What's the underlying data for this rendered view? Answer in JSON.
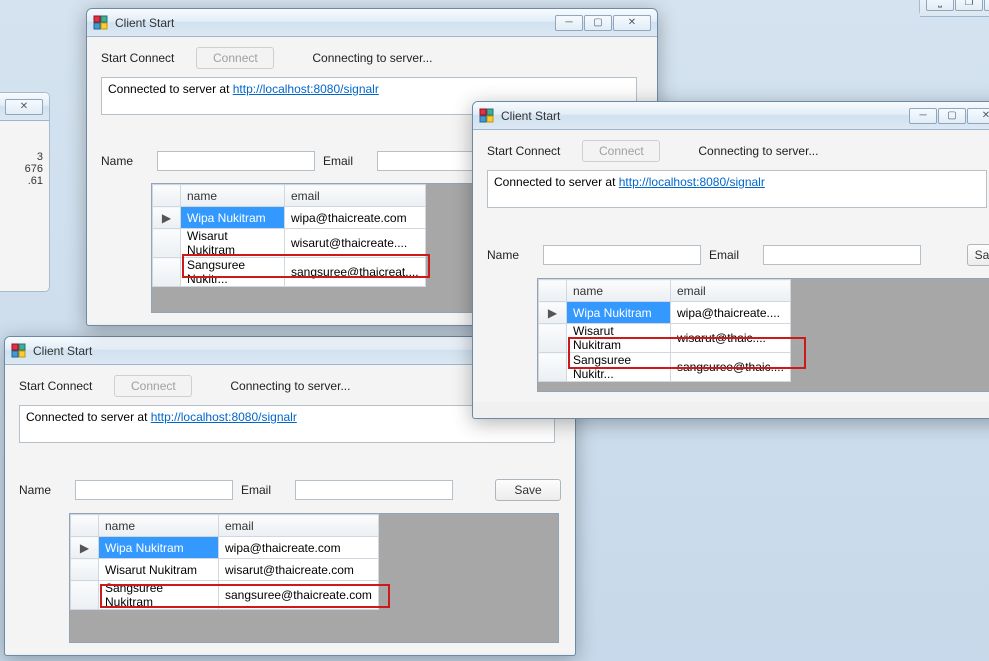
{
  "top_window_partial": {
    "control_min": "⎵",
    "control_max": "❐",
    "control_close": "✕",
    "stray_text": "3\n676\n.61"
  },
  "left_window_partial": {
    "control_close": "✕"
  },
  "window1": {
    "title": "Client Start",
    "start_connect": "Start Connect",
    "connect_btn": "Connect",
    "status": "Connecting to server...",
    "log_prefix": "Connected to server at ",
    "log_link": "http://localhost:8080/signalr",
    "name_label": "Name",
    "email_label": "Email",
    "control_min": "─",
    "control_max": "▢",
    "control_close": "✕",
    "grid": {
      "cols": [
        "name",
        "email"
      ],
      "rows": [
        {
          "selector": "▶",
          "name": "Wipa Nukitram",
          "email": "wipa@thaicreate.com",
          "selected": true
        },
        {
          "selector": "",
          "name": "Wisarut Nukitram",
          "email": "wisarut@thaicreate....",
          "selected": false
        },
        {
          "selector": "",
          "name": "Sangsuree Nukitr...",
          "email": "sangsuree@thaicreat....",
          "selected": false
        }
      ]
    }
  },
  "window2": {
    "title": "Client Start",
    "start_connect": "Start Connect",
    "connect_btn": "Connect",
    "status": "Connecting to server...",
    "log_prefix": "Connected to server at ",
    "log_link": "http://localhost:8080/signalr",
    "name_label": "Name",
    "email_label": "Email",
    "save_btn": "Sa",
    "control_min": "─",
    "control_max": "▢",
    "control_close": "✕",
    "grid": {
      "cols": [
        "name",
        "email"
      ],
      "rows": [
        {
          "selector": "▶",
          "name": "Wipa Nukitram",
          "email": "wipa@thaicreate....",
          "selected": true
        },
        {
          "selector": "",
          "name": "Wisarut Nukitram",
          "email": "wisarut@thaic....",
          "selected": false
        },
        {
          "selector": "",
          "name": "Sangsuree Nukitr...",
          "email": "sangsuree@thaic....",
          "selected": false
        }
      ]
    }
  },
  "window3": {
    "title": "Client Start",
    "start_connect": "Start Connect",
    "connect_btn": "Connect",
    "status": "Connecting to server...",
    "log_prefix": "Connected to server at ",
    "log_link": "http://localhost:8080/signalr",
    "name_label": "Name",
    "email_label": "Email",
    "save_btn": "Save",
    "grid": {
      "cols": [
        "name",
        "email"
      ],
      "rows": [
        {
          "selector": "▶",
          "name": "Wipa Nukitram",
          "email": "wipa@thaicreate.com",
          "selected": true
        },
        {
          "selector": "",
          "name": "Wisarut Nukitram",
          "email": "wisarut@thaicreate.com",
          "selected": false
        },
        {
          "selector": "",
          "name": "Sangsuree Nukitram",
          "email": "sangsuree@thaicreate.com",
          "selected": false
        }
      ]
    }
  }
}
